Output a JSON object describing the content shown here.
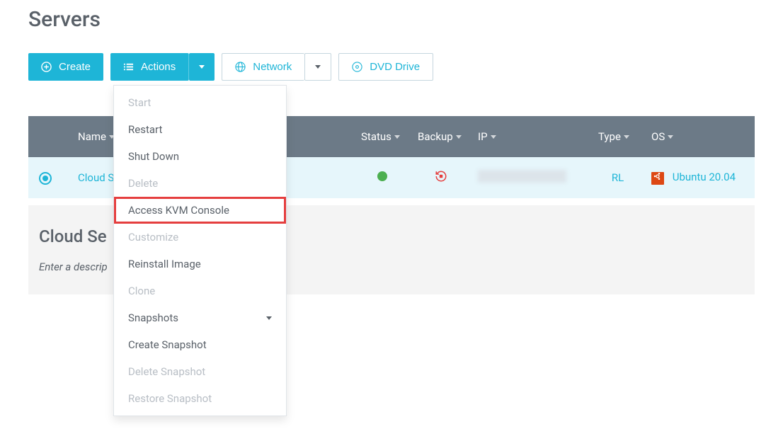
{
  "page": {
    "title": "Servers"
  },
  "toolbar": {
    "create_label": "Create",
    "actions_label": "Actions",
    "network_label": "Network",
    "dvd_label": "DVD Drive"
  },
  "actions_menu": {
    "start": "Start",
    "restart": "Restart",
    "shutdown": "Shut Down",
    "delete": "Delete",
    "kvm": "Access KVM Console",
    "customize": "Customize",
    "reinstall": "Reinstall Image",
    "clone": "Clone",
    "snapshots": "Snapshots",
    "create_snapshot": "Create Snapshot",
    "delete_snapshot": "Delete Snapshot",
    "restore_snapshot": "Restore Snapshot"
  },
  "table": {
    "headers": {
      "name": "Name",
      "status": "Status",
      "backup": "Backup",
      "ip": "IP",
      "type": "Type",
      "os": "OS"
    },
    "row": {
      "name": "Cloud Se",
      "type": "RL",
      "os_name": "Ubuntu 20.04"
    }
  },
  "detail": {
    "title": "Cloud Se",
    "description": "Enter a descrip"
  }
}
